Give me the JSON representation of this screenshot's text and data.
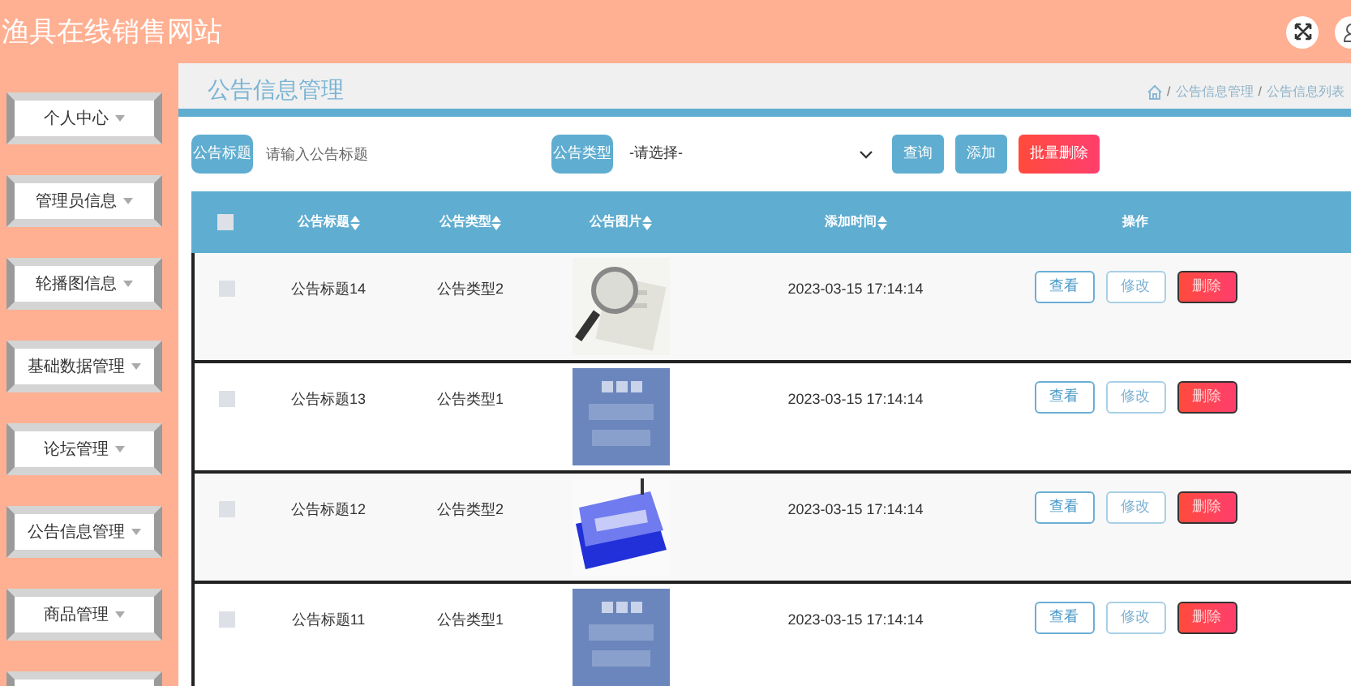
{
  "header": {
    "title": "渔具在线销售网站"
  },
  "sidebar": {
    "items": [
      {
        "kind": "menu",
        "label": "个人中心"
      },
      {
        "kind": "menu",
        "label": "管理员信息"
      },
      {
        "kind": "menu",
        "label": "轮播图信息"
      },
      {
        "kind": "menu",
        "label": "基础数据管理"
      },
      {
        "kind": "menu",
        "label": "论坛管理"
      },
      {
        "kind": "menu",
        "label": "公告信息管理"
      },
      {
        "kind": "menu",
        "label": "商品管理"
      },
      {
        "kind": "cut_off"
      }
    ]
  },
  "page": {
    "title": "公告信息管理",
    "breadcrumb": [
      {
        "separator": "/",
        "label": "公告信息管理"
      },
      {
        "separator": "/",
        "label": "公告信息列表"
      }
    ]
  },
  "search": {
    "title_label": "公告标题",
    "title_placeholder": "请输入公告标题",
    "type_label": "公告类型",
    "type_value": "-请选择-",
    "buttons": [
      {
        "label": "查询",
        "kind": "primary"
      },
      {
        "label": "添加",
        "kind": "primary"
      },
      {
        "label": "批量删除",
        "kind": "danger"
      }
    ]
  },
  "table": {
    "select_all": {
      "checked": false
    },
    "columns": [
      {
        "label": "公告标题",
        "sortable": true
      },
      {
        "label": "公告类型",
        "sortable": true
      },
      {
        "label": "公告图片",
        "sortable": true
      },
      {
        "label": "添加时间",
        "sortable": true
      },
      {
        "label": "操作",
        "sortable": false
      }
    ],
    "rows": [
      {
        "checked": false,
        "title": "公告标题14",
        "type": "公告类型2",
        "picture": {
          "kind": "picture"
        },
        "time": "2023-03-15 17:14:14",
        "actions": [
          {
            "label": "查看",
            "kind": "view"
          },
          {
            "label": "修改",
            "kind": "edit"
          },
          {
            "label": "删除",
            "kind": "delete"
          }
        ]
      },
      {
        "checked": false,
        "title": "公告标题13",
        "type": "公告类型1",
        "picture": {
          "kind": "picture"
        },
        "time": "2023-03-15 17:14:14",
        "actions": [
          {
            "label": "查看",
            "kind": "view"
          },
          {
            "label": "修改",
            "kind": "edit"
          },
          {
            "label": "删除",
            "kind": "delete"
          }
        ]
      },
      {
        "checked": false,
        "title": "公告标题12",
        "type": "公告类型2",
        "picture": {
          "kind": "picture"
        },
        "time": "2023-03-15 17:14:14",
        "actions": [
          {
            "label": "查看",
            "kind": "view"
          },
          {
            "label": "修改",
            "kind": "edit"
          },
          {
            "label": "删除",
            "kind": "delete"
          }
        ]
      },
      {
        "checked": false,
        "title": "公告标题11",
        "type": "公告类型1",
        "picture": {
          "kind": "picture"
        },
        "time": "2023-03-15 17:14:14",
        "actions": [
          {
            "label": "查看",
            "kind": "view"
          },
          {
            "label": "修改",
            "kind": "edit"
          },
          {
            "label": "删除",
            "kind": "delete"
          }
        ]
      }
    ]
  }
}
